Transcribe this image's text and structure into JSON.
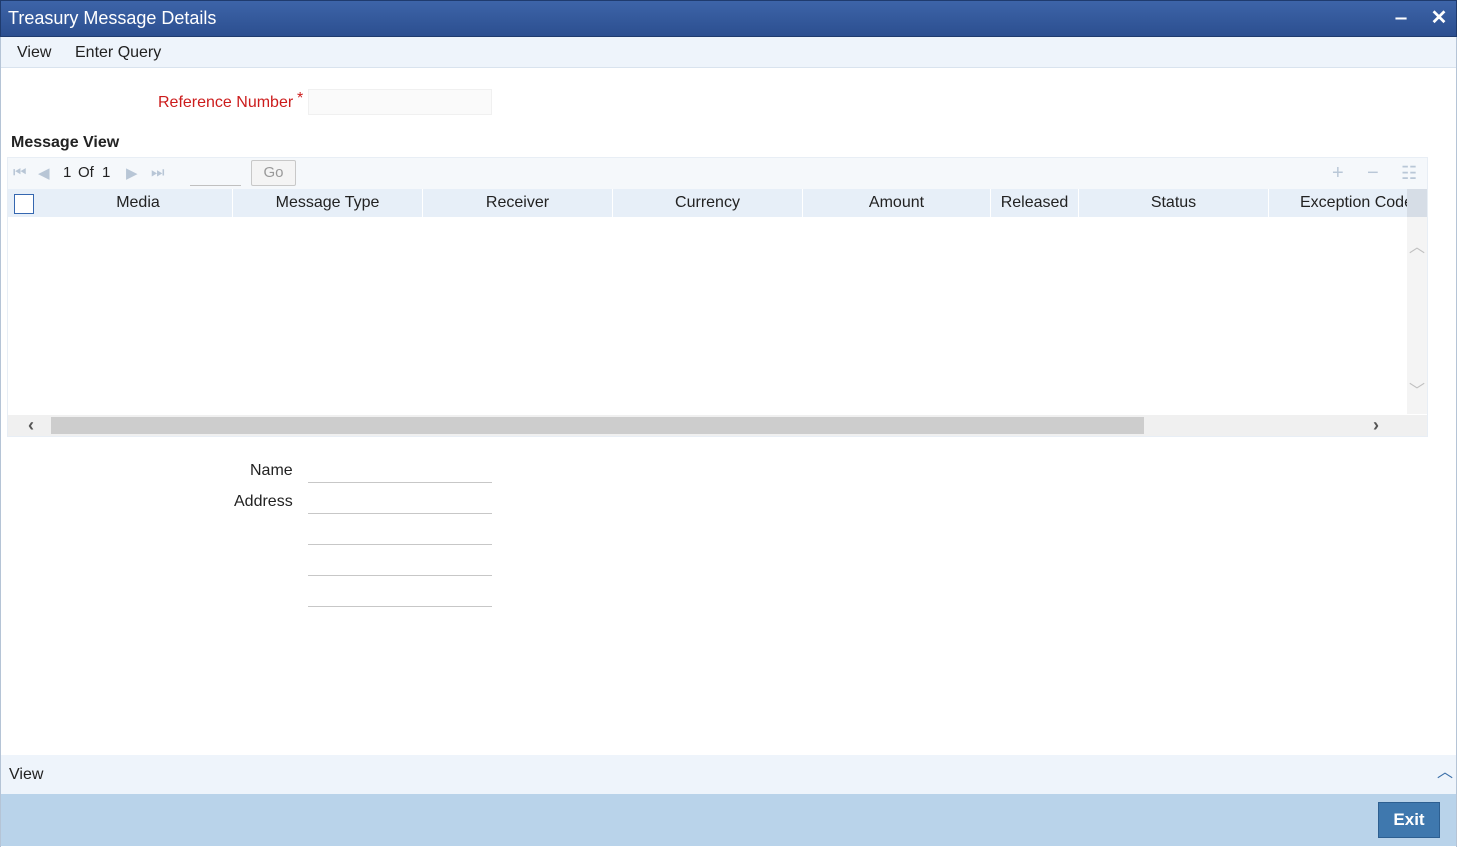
{
  "window": {
    "title": "Treasury Message Details",
    "minimize_label": "‒",
    "close_label": "✕"
  },
  "menu": {
    "items": [
      "View",
      "Enter Query"
    ]
  },
  "form": {
    "reference_number_label": "Reference Number",
    "required_marker": "*",
    "reference_number_value": "",
    "name_label": "Name",
    "address_label": "Address"
  },
  "message_view": {
    "title": "Message View",
    "pager": {
      "current": "1",
      "of_label": "Of",
      "total": "1",
      "go_label": "Go"
    },
    "columns": [
      "Media",
      "Message Type",
      "Receiver",
      "Currency",
      "Amount",
      "Released",
      "Status",
      "Exception Code"
    ],
    "rows": []
  },
  "footer": {
    "view_label": "View",
    "exit_label": "Exit"
  },
  "colors": {
    "titlebar": "#2c4f90",
    "accent": "#3f78ae",
    "required": "#cc1c1c",
    "footer": "#b9d3ea"
  }
}
